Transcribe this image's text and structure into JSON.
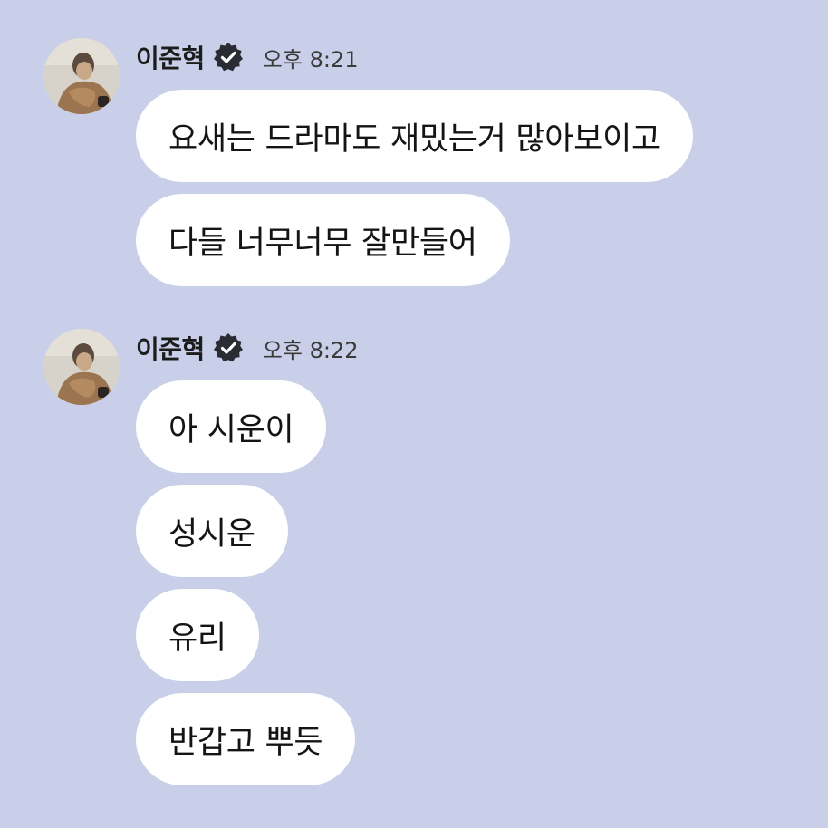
{
  "colors": {
    "background": "#c9cfe8",
    "bubble": "#ffffff",
    "verified_badge": "#2a2c33"
  },
  "messages": [
    {
      "sender": {
        "name": "이준혁",
        "avatar_icon": "profile-photo",
        "badge_icon": "verified-badge-icon"
      },
      "time": "오후 8:21",
      "bubbles": [
        "요새는 드라마도 재밌는거 많아보이고",
        "다들 너무너무 잘만들어"
      ]
    },
    {
      "sender": {
        "name": "이준혁",
        "avatar_icon": "profile-photo",
        "badge_icon": "verified-badge-icon"
      },
      "time": "오후 8:22",
      "bubbles": [
        "아 시운이",
        "성시운",
        "유리",
        "반갑고 뿌듯"
      ]
    }
  ]
}
